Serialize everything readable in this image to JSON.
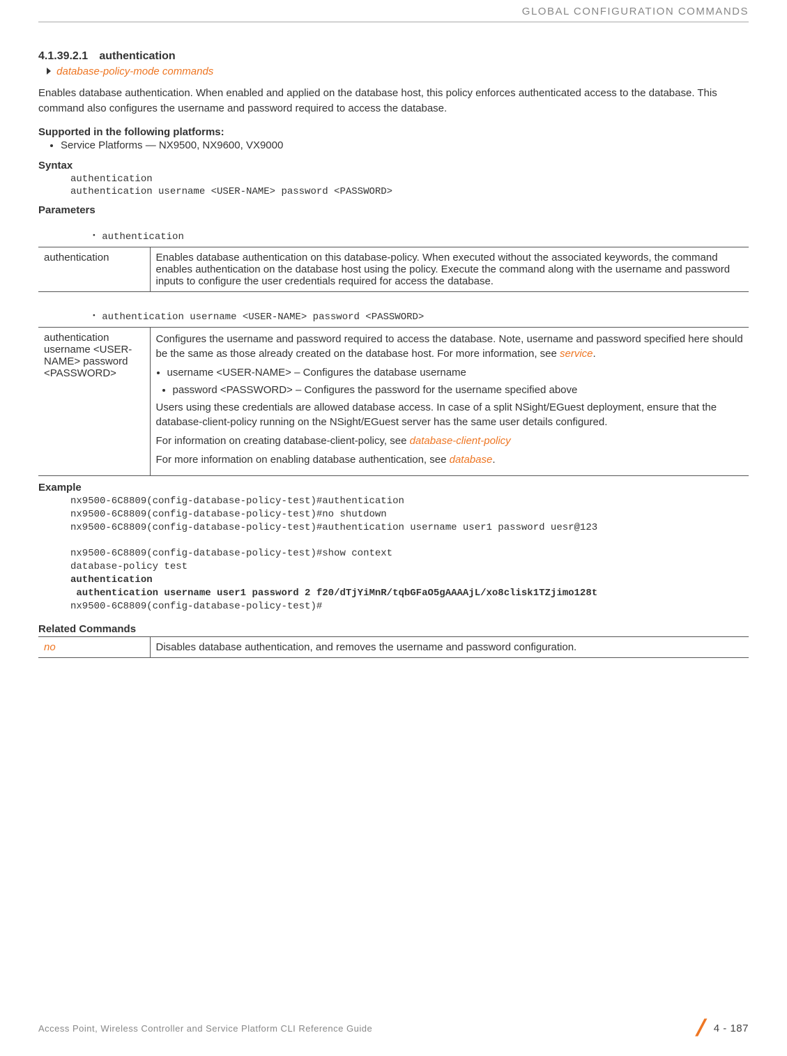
{
  "header": {
    "chapter": "GLOBAL CONFIGURATION COMMANDS"
  },
  "section": {
    "num": "4.1.39.2.1",
    "title": "authentication"
  },
  "breadcrumb": {
    "link": "database-policy-mode commands"
  },
  "intro": "Enables database authentication. When enabled and applied on the database host, this policy enforces authenticated access to the database. This command also configures the username and password required to access the database.",
  "supported": {
    "heading": "Supported in the following platforms:",
    "items": [
      "Service Platforms — NX9500, NX9600, VX9000"
    ]
  },
  "syntax": {
    "heading": "Syntax",
    "lines": "authentication\nauthentication username <USER-NAME> password <PASSWORD>"
  },
  "parameters": {
    "heading": "Parameters",
    "bullet1": "authentication",
    "table1": {
      "col1": "authentication",
      "col2": "Enables database authentication on this database-policy. When executed without the associated keywords, the command enables authentication on the database host using the policy. Execute the command along with the username and password inputs to configure the user credentials required for access the database."
    },
    "bullet2": "authentication username <USER-NAME> password <PASSWORD>",
    "table2": {
      "col1": "authentication username <USER-NAME> password <PASSWORD>",
      "p1_a": "Configures the username and password required to access the database. Note, username and password specified here should be the same as those already created on the database host. For more information, see ",
      "p1_link": "service",
      "p1_b": ".",
      "ul1": "username <USER-NAME> – Configures the database username",
      "ul1_sub": "password <PASSWORD> – Configures the password for the username specified above",
      "p2": "Users using these credentials are allowed database access. In case of a split NSight/EGuest deployment, ensure that the database-client-policy running on the NSight/EGuest server has the same user details configured.",
      "p3_a": "For information on creating database-client-policy, see ",
      "p3_link": "database-client-policy",
      "p4_a": "For more information on enabling database authentication, see ",
      "p4_link": "database",
      "p4_b": "."
    }
  },
  "example": {
    "heading": "Example",
    "l1": "nx9500-6C8809(config-database-policy-test)#authentication",
    "l2": "nx9500-6C8809(config-database-policy-test)#no shutdown",
    "l3": "nx9500-6C8809(config-database-policy-test)#authentication username user1 password uesr@123",
    "l5": "nx9500-6C8809(config-database-policy-test)#show context",
    "l6": "database-policy test",
    "l7": " authentication",
    "l8": " authentication username user1 password 2 f20/dTjYiMnR/tqbGFaO5gAAAAjL/xo8clisk1TZjimo128t",
    "l9": "nx9500-6C8809(config-database-policy-test)#"
  },
  "related": {
    "heading": "Related Commands",
    "table": {
      "col1": "no",
      "col2": "Disables database authentication, and removes the username and password configuration."
    }
  },
  "footer": {
    "left": "Access Point, Wireless Controller and Service Platform CLI Reference Guide",
    "page": "4 - 187"
  }
}
